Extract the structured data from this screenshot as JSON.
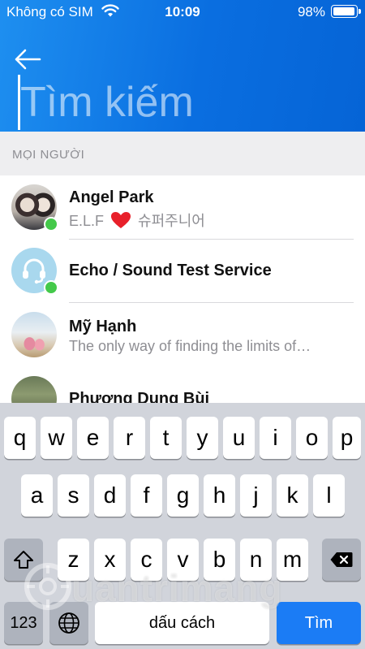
{
  "status_bar": {
    "carrier": "Không có SIM",
    "time": "10:09",
    "battery": "98%"
  },
  "search": {
    "placeholder": "Tìm kiếm",
    "value": ""
  },
  "section": {
    "title": "MỌI NGƯỜI"
  },
  "contacts": [
    {
      "name": "Angel Park",
      "subtitle_left": "E.L.F",
      "subtitle_right": "슈퍼주니어",
      "online": true
    },
    {
      "name": "Echo / Sound Test Service",
      "subtitle": "",
      "online": true
    },
    {
      "name": "Mỹ Hạnh",
      "subtitle": "The only way of finding the limits of…",
      "online": false
    },
    {
      "name": "Phương Dung Bùi",
      "subtitle": "",
      "online": false
    }
  ],
  "keyboard": {
    "row1": [
      "q",
      "w",
      "e",
      "r",
      "t",
      "y",
      "u",
      "i",
      "o",
      "p"
    ],
    "row2": [
      "a",
      "s",
      "d",
      "f",
      "g",
      "h",
      "j",
      "k",
      "l"
    ],
    "row3": [
      "z",
      "x",
      "c",
      "v",
      "b",
      "n",
      "m"
    ],
    "numbers_label": "123",
    "space_label": "dấu cách",
    "search_label": "Tìm"
  },
  "watermark": "uantrimang",
  "colors": {
    "header_blue": "#0a6ee0",
    "online_green": "#44c94a",
    "search_key_blue": "#1b7cf5"
  }
}
